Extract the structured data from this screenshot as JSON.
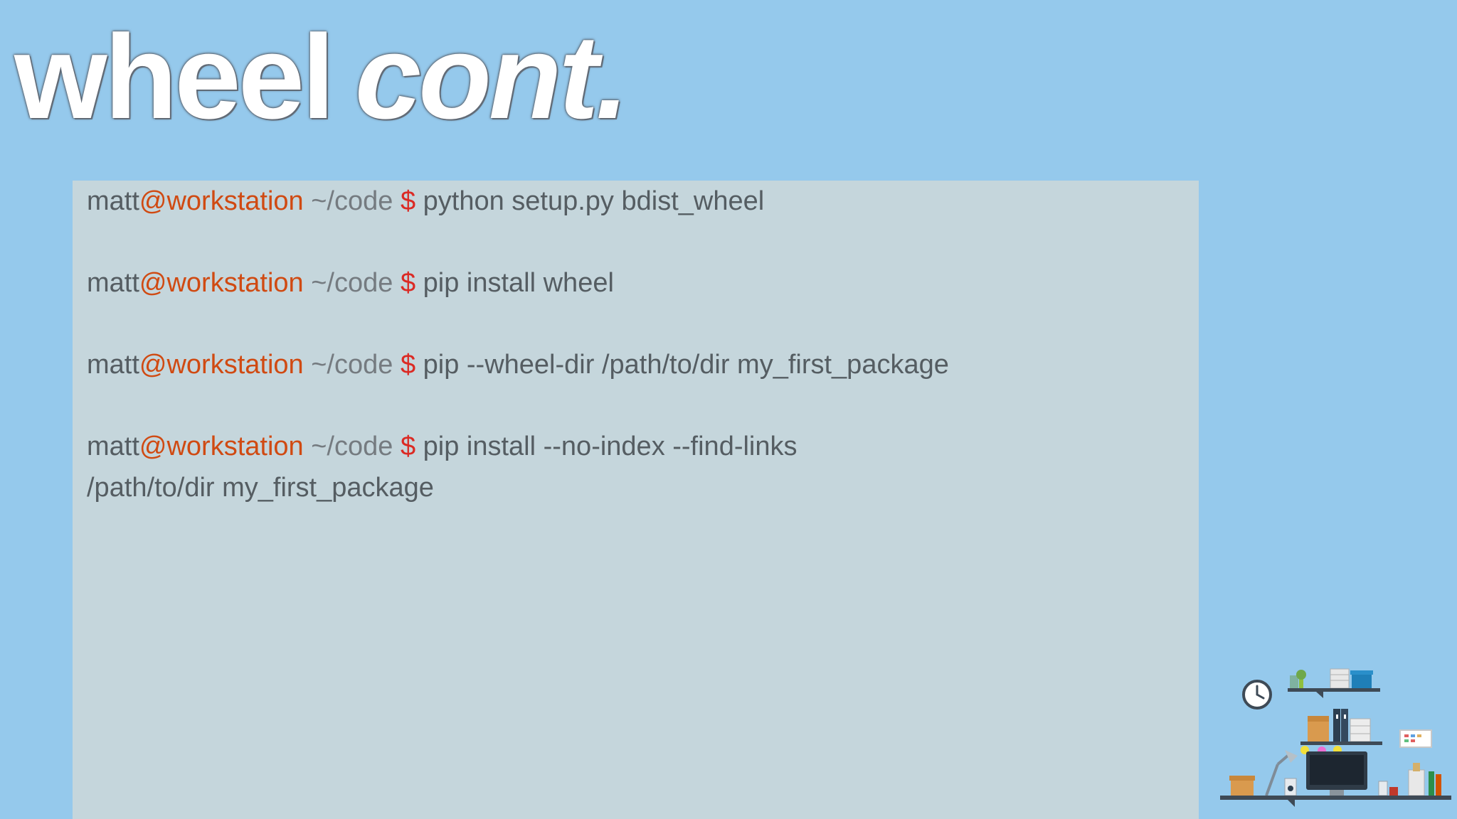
{
  "title": {
    "word1": "wheel",
    "word2": "cont."
  },
  "prompt": {
    "user": "matt",
    "host": "@workstation",
    "path": " ~/code ",
    "symbol": "$"
  },
  "commands": [
    " python setup.py bdist_wheel",
    " pip install wheel",
    " pip --wheel-dir /path/to/dir my_first_package",
    " pip install --no-index --find-links"
  ],
  "continuation": "/path/to/dir my_first_package",
  "colors": {
    "background": "#95c9ec",
    "terminal": "#c5d6dc",
    "text": "#555d62",
    "host": "#d04a12",
    "dollar": "#db2a24"
  },
  "icons": [
    "clock-icon",
    "monitor-icon",
    "desk-shelf-illustration"
  ]
}
